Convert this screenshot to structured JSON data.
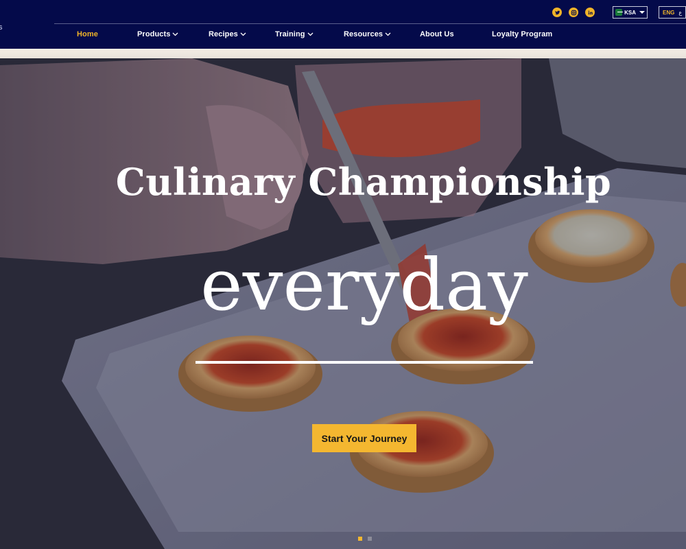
{
  "header": {
    "logo_fragment": "s",
    "social": [
      {
        "icon": "twitter-icon"
      },
      {
        "icon": "instagram-icon"
      },
      {
        "icon": "linkedin-icon"
      }
    ],
    "country": {
      "label": "KSA",
      "flag_icon": "saudi-flag-icon"
    },
    "language": {
      "label": "ENG",
      "alt": "ع"
    },
    "nav": [
      {
        "label": "Home",
        "active": true,
        "dropdown": false
      },
      {
        "label": "Products",
        "active": false,
        "dropdown": true
      },
      {
        "label": "Recipes",
        "active": false,
        "dropdown": true
      },
      {
        "label": "Training",
        "active": false,
        "dropdown": true
      },
      {
        "label": "Resources",
        "active": false,
        "dropdown": true
      },
      {
        "label": "About Us",
        "active": false,
        "dropdown": false
      },
      {
        "label": "Loyalty Program",
        "active": false,
        "dropdown": false
      }
    ]
  },
  "hero": {
    "title": "Culinary Championship",
    "subtitle": "everyday",
    "cta_label": "Start Your Journey",
    "slides": 2,
    "active_slide": 1
  },
  "colors": {
    "header_bg": "#040a4a",
    "accent": "#f4b730",
    "nav_text": "#ffffff"
  }
}
